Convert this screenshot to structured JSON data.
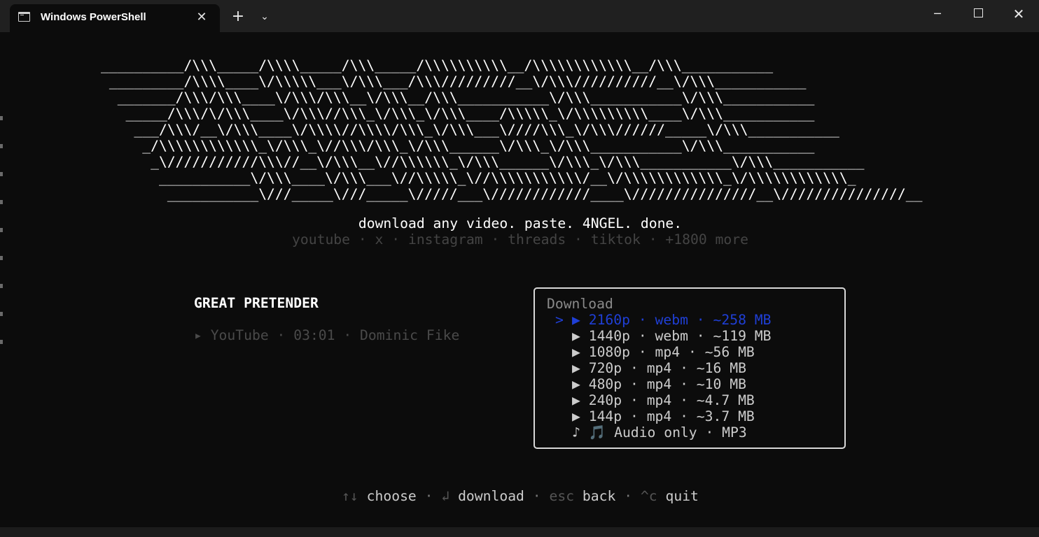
{
  "window": {
    "tab_title": "Windows PowerShell",
    "tab_icon": "powershell-icon",
    "close_tab_symbol": "✕",
    "new_tab_symbol": "+",
    "dropdown_symbol": "⌄",
    "minimize_symbol": "─",
    "close_symbol": "✕"
  },
  "banner": {
    "lines": [
      "__________/\\\\\\_____/\\\\\\\\_____/\\\\\\_____/\\\\\\\\\\\\\\\\\\\\__/\\\\\\\\\\\\\\\\\\\\\\\\__/\\\\\\___________",
      " _________/\\\\\\\\____\\/\\\\\\\\\\___\\/\\\\\\___/\\\\\\/////////__\\/\\\\\\//////////__\\/\\\\\\___________",
      "  _______/\\\\\\/\\\\\\____\\/\\\\\\/\\\\\\__\\/\\\\\\__/\\\\\\___________\\/\\\\\\___________\\/\\\\\\___________",
      "   _____/\\\\\\/\\/\\\\\\____\\/\\\\\\//\\\\\\_\\/\\\\\\_\\/\\\\\\____/\\\\\\\\\\_\\/\\\\\\\\\\\\\\\\\\____\\/\\\\\\___________",
      "    ___/\\\\\\/__\\/\\\\\\____\\/\\\\\\\\//\\\\\\\\/\\\\\\_\\/\\\\\\___\\////\\\\\\_\\/\\\\\\//////_____\\/\\\\\\___________",
      "     _/\\\\\\\\\\\\\\\\\\\\\\\\_\\/\\\\\\_\\//\\\\\\/\\\\\\_\\/\\\\\\______\\/\\\\\\_\\/\\\\\\___________\\/\\\\\\___________",
      "      _\\///////////\\\\\\//__\\/\\\\\\__\\//\\\\\\\\\\\\_\\/\\\\\\______\\/\\\\\\_\\/\\\\\\___________\\/\\\\\\___________",
      "       ___________\\/\\\\\\____\\/\\\\\\___\\//\\\\\\\\\\_\\//\\\\\\\\\\\\\\\\\\\\\\/__\\/\\\\\\\\\\\\\\\\\\\\\\\\_\\/\\\\\\\\\\\\\\\\\\\\\\\\_",
      "        ___________\\///_____\\///_____\\/////___\\////////////____\\///////////////__\\///////////////__"
    ]
  },
  "tagline": "download any video. paste. 4NGEL. done.",
  "sites": "youtube · x · instagram · threads · tiktok · +1800 more",
  "video": {
    "title": "GREAT PRETENDER",
    "meta": "▸ YouTube · 03:01 · Dominic Fike"
  },
  "download_panel": {
    "title": "Download",
    "cursor": ">",
    "options": [
      {
        "marker": "▶",
        "label": "2160p · webm · ~258 MB",
        "selected": true
      },
      {
        "marker": "▶",
        "label": "1440p · webm · ~119 MB",
        "selected": false
      },
      {
        "marker": "▶",
        "label": "1080p · mp4 · ~56 MB",
        "selected": false
      },
      {
        "marker": "▶",
        "label": "720p · mp4 · ~16 MB",
        "selected": false
      },
      {
        "marker": "▶",
        "label": "480p · mp4 · ~10 MB",
        "selected": false
      },
      {
        "marker": "▶",
        "label": "240p · mp4 · ~4.7 MB",
        "selected": false
      },
      {
        "marker": "▶",
        "label": "144p · mp4 · ~3.7 MB",
        "selected": false
      },
      {
        "marker": "♪",
        "note_icon": "🎵",
        "label": "Audio only · MP3",
        "selected": false
      }
    ]
  },
  "footer": {
    "choose_key": "↑↓",
    "choose": "choose",
    "download_key": "↲",
    "download": "download",
    "back_key": "esc",
    "back": "back",
    "quit_key": "^c",
    "quit": "quit",
    "separator": "·"
  }
}
